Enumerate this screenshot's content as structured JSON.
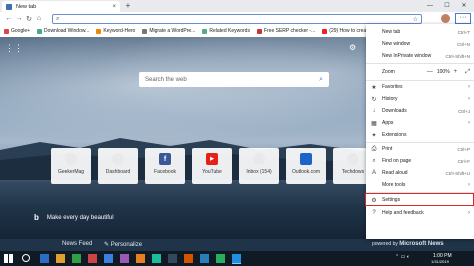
{
  "browser": {
    "tab_title": "New tab",
    "tab_close": "×",
    "new_tab_button": "+",
    "window_controls": [
      "—",
      "☐",
      "✕"
    ],
    "address_value": "",
    "more_button": "···"
  },
  "favorites_bar": [
    {
      "label": "Google+"
    },
    {
      "label": "Download Window..."
    },
    {
      "label": "Keyword-Hero"
    },
    {
      "label": "Migrate a WordPre..."
    },
    {
      "label": "Related Keywords"
    },
    {
      "label": "Free SERP checker -..."
    },
    {
      "label": "(29) How to create..."
    }
  ],
  "newtab": {
    "search_placeholder": "Search the web",
    "tiles": [
      {
        "label": "GeekerMag",
        "icon": "",
        "color": "#e9e9e9"
      },
      {
        "label": "Dashboard",
        "icon": "",
        "color": "#e9e9e9"
      },
      {
        "label": "Facebook",
        "icon": "f",
        "color": "#3b5998"
      },
      {
        "label": "YouTube",
        "icon": "▶",
        "color": "#e62117"
      },
      {
        "label": "Inbox (154)",
        "icon": "",
        "color": "#e9e9e9"
      },
      {
        "label": "Outlook.com",
        "icon": "",
        "color": "#1e64c8"
      },
      {
        "label": "Techdows",
        "icon": "",
        "color": "#e9e9e9"
      }
    ],
    "bing_text": "Make every day beautiful",
    "news_feed": "News Feed",
    "personalize": "Personalize",
    "powered_by": "powered by",
    "powered_brand": "Microsoft News"
  },
  "menu": {
    "items": [
      {
        "label": "New tab",
        "shortcut": "Ctrl+T",
        "icon": "",
        "chevron": ""
      },
      {
        "label": "New window",
        "shortcut": "Ctrl+N",
        "icon": "",
        "chevron": ""
      },
      {
        "label": "New InPrivate window",
        "shortcut": "Ctrl+Shift+N",
        "icon": "",
        "chevron": ""
      },
      {
        "label": "Favorites",
        "shortcut": "",
        "icon": "★",
        "chevron": "›"
      },
      {
        "label": "History",
        "shortcut": "",
        "icon": "↻",
        "chevron": "›"
      },
      {
        "label": "Downloads",
        "shortcut": "Ctrl+J",
        "icon": "↓",
        "chevron": ""
      },
      {
        "label": "Apps",
        "shortcut": "",
        "icon": "▦",
        "chevron": "›"
      },
      {
        "label": "Extensions",
        "shortcut": "",
        "icon": "✦",
        "chevron": ""
      },
      {
        "label": "Print",
        "shortcut": "Ctrl+P",
        "icon": "⎙",
        "chevron": ""
      },
      {
        "label": "Find on page",
        "shortcut": "Ctrl+F",
        "icon": "⌕",
        "chevron": ""
      },
      {
        "label": "Read aloud",
        "shortcut": "Ctrl+Shift+U",
        "icon": "A",
        "chevron": ""
      },
      {
        "label": "More tools",
        "shortcut": "",
        "icon": "",
        "chevron": "›"
      },
      {
        "label": "Settings",
        "shortcut": "",
        "icon": "⚙",
        "chevron": ""
      },
      {
        "label": "Help and feedback",
        "shortcut": "",
        "icon": "?",
        "chevron": "›"
      }
    ],
    "zoom_label": "Zoom",
    "zoom_minus": "—",
    "zoom_value": "100%",
    "zoom_plus": "+",
    "zoom_fullscreen": "⤢"
  },
  "taskbar": {
    "clock_time": "1:00 PM",
    "clock_date": "1/31/2019"
  },
  "colors": {
    "accent": "#4a7bd0",
    "highlight": "#d42b2b"
  }
}
